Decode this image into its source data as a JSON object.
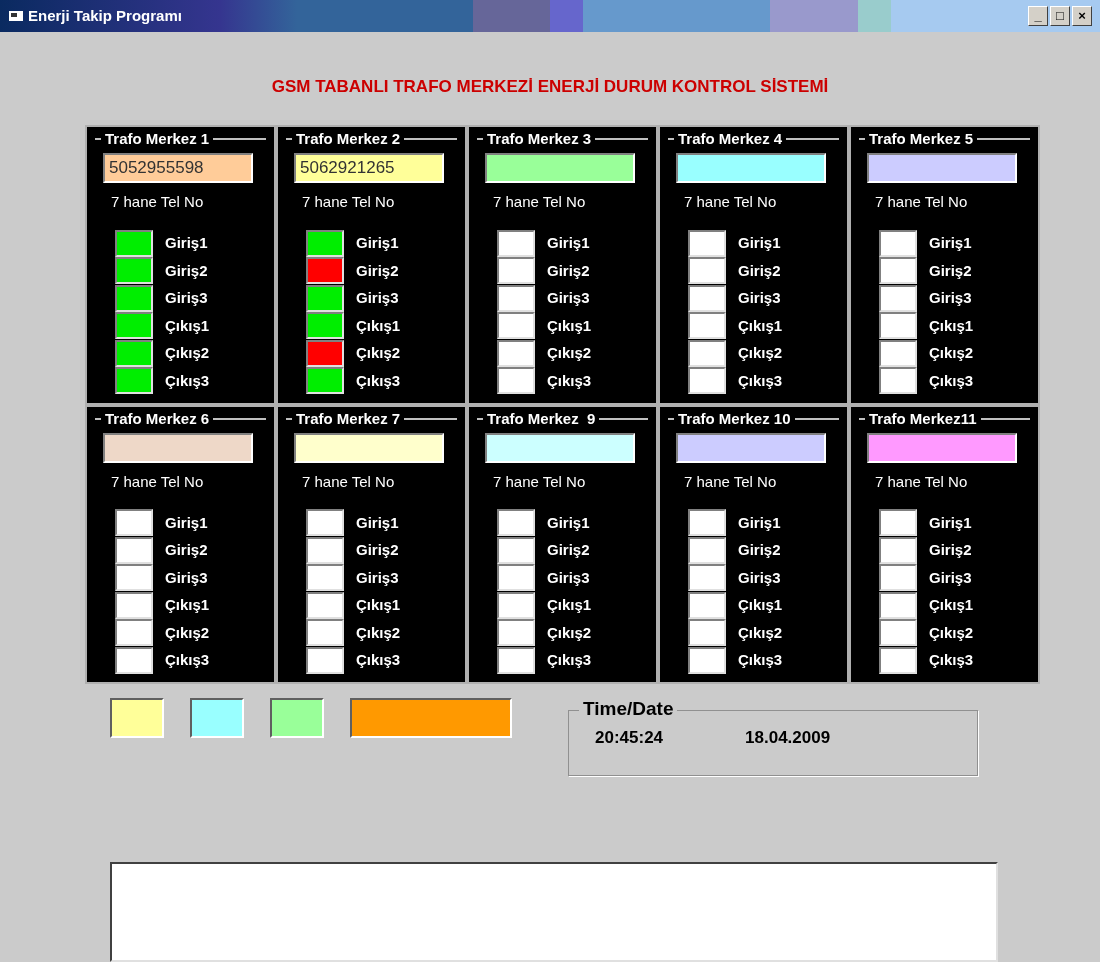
{
  "window": {
    "title": "Enerji Takip Programı",
    "controls": [
      "_",
      "□",
      "×"
    ]
  },
  "heading": "GSM TABANLI TRAFO MERKEZİ ENERJİ DURUM KONTROL SİSTEMİ",
  "stations": [
    {
      "title": "Trafo Merkez 1",
      "phone": "5052955598",
      "color": "#ffcc99",
      "hint": "7 hane Tel No",
      "signals": [
        {
          "label": "Giriş1",
          "color": "#00ee00"
        },
        {
          "label": "Giriş2",
          "color": "#00ee00"
        },
        {
          "label": "Giriş3",
          "color": "#00ee00"
        },
        {
          "label": "Çıkış1",
          "color": "#00ee00"
        },
        {
          "label": "Çıkış2",
          "color": "#00ee00"
        },
        {
          "label": "Çıkış3",
          "color": "#00ee00"
        }
      ]
    },
    {
      "title": "Trafo Merkez 2",
      "phone": "5062921265",
      "color": "#ffff99",
      "hint": "7 hane Tel No",
      "signals": [
        {
          "label": "Giriş1",
          "color": "#00ee00"
        },
        {
          "label": "Giriş2",
          "color": "#ff0000"
        },
        {
          "label": "Giriş3",
          "color": "#00ee00"
        },
        {
          "label": "Çıkış1",
          "color": "#00ee00"
        },
        {
          "label": "Çıkış2",
          "color": "#ff0000"
        },
        {
          "label": "Çıkış3",
          "color": "#00ee00"
        }
      ]
    },
    {
      "title": "Trafo Merkez 3",
      "color": "#99ff99",
      "hint": "7 hane Tel No",
      "signals": [
        {
          "label": "Giriş1",
          "color": "#ffffff"
        },
        {
          "label": "Giriş2",
          "color": "#ffffff"
        },
        {
          "label": "Giriş3",
          "color": "#ffffff"
        },
        {
          "label": "Çıkış1",
          "color": "#ffffff"
        },
        {
          "label": "Çıkış2",
          "color": "#ffffff"
        },
        {
          "label": "Çıkış3",
          "color": "#ffffff"
        }
      ]
    },
    {
      "title": "Trafo Merkez 4",
      "color": "#99ffff",
      "hint": "7 hane Tel No",
      "signals": [
        {
          "label": "Giriş1",
          "color": "#ffffff"
        },
        {
          "label": "Giriş2",
          "color": "#ffffff"
        },
        {
          "label": "Giriş3",
          "color": "#ffffff"
        },
        {
          "label": "Çıkış1",
          "color": "#ffffff"
        },
        {
          "label": "Çıkış2",
          "color": "#ffffff"
        },
        {
          "label": "Çıkış3",
          "color": "#ffffff"
        }
      ]
    },
    {
      "title": "Trafo Merkez 5",
      "color": "#ccccff",
      "hint": "7 hane Tel No",
      "signals": [
        {
          "label": "Giriş1",
          "color": "#ffffff"
        },
        {
          "label": "Giriş2",
          "color": "#ffffff"
        },
        {
          "label": "Giriş3",
          "color": "#ffffff"
        },
        {
          "label": "Çıkış1",
          "color": "#ffffff"
        },
        {
          "label": "Çıkış2",
          "color": "#ffffff"
        },
        {
          "label": "Çıkış3",
          "color": "#ffffff"
        }
      ]
    },
    {
      "title": "Trafo Merkez 6",
      "color": "#eed8c8",
      "hint": "7 hane Tel No",
      "signals": [
        {
          "label": "Giriş1",
          "color": "#ffffff"
        },
        {
          "label": "Giriş2",
          "color": "#ffffff"
        },
        {
          "label": "Giriş3",
          "color": "#ffffff"
        },
        {
          "label": "Çıkış1",
          "color": "#ffffff"
        },
        {
          "label": "Çıkış2",
          "color": "#ffffff"
        },
        {
          "label": "Çıkış3",
          "color": "#ffffff"
        }
      ]
    },
    {
      "title": "Trafo Merkez 7",
      "color": "#ffffcc",
      "hint": "7 hane Tel No",
      "signals": [
        {
          "label": "Giriş1",
          "color": "#ffffff"
        },
        {
          "label": "Giriş2",
          "color": "#ffffff"
        },
        {
          "label": "Giriş3",
          "color": "#ffffff"
        },
        {
          "label": "Çıkış1",
          "color": "#ffffff"
        },
        {
          "label": "Çıkış2",
          "color": "#ffffff"
        },
        {
          "label": "Çıkış3",
          "color": "#ffffff"
        }
      ]
    },
    {
      "title": "Trafo Merkez  9",
      "color": "#ccffff",
      "hint": "7 hane Tel No",
      "signals": [
        {
          "label": "Giriş1",
          "color": "#ffffff"
        },
        {
          "label": "Giriş2",
          "color": "#ffffff"
        },
        {
          "label": "Giriş3",
          "color": "#ffffff"
        },
        {
          "label": "Çıkış1",
          "color": "#ffffff"
        },
        {
          "label": "Çıkış2",
          "color": "#ffffff"
        },
        {
          "label": "Çıkış3",
          "color": "#ffffff"
        }
      ]
    },
    {
      "title": "Trafo Merkez 10",
      "color": "#ccccff",
      "hint": "7 hane Tel No",
      "signals": [
        {
          "label": "Giriş1",
          "color": "#ffffff"
        },
        {
          "label": "Giriş2",
          "color": "#ffffff"
        },
        {
          "label": "Giriş3",
          "color": "#ffffff"
        },
        {
          "label": "Çıkış1",
          "color": "#ffffff"
        },
        {
          "label": "Çıkış2",
          "color": "#ffffff"
        },
        {
          "label": "Çıkış3",
          "color": "#ffffff"
        }
      ]
    },
    {
      "title": "Trafo Merkez11",
      "color": "#ff99ff",
      "hint": "7 hane Tel No",
      "signals": [
        {
          "label": "Giriş1",
          "color": "#ffffff"
        },
        {
          "label": "Giriş2",
          "color": "#ffffff"
        },
        {
          "label": "Giriş3",
          "color": "#ffffff"
        },
        {
          "label": "Çıkış1",
          "color": "#ffffff"
        },
        {
          "label": "Çıkış2",
          "color": "#ffffff"
        },
        {
          "label": "Çıkış3",
          "color": "#ffffff"
        }
      ]
    }
  ],
  "swatches": [
    {
      "color": "#ffff99"
    },
    {
      "color": "#99ffff"
    },
    {
      "color": "#99ff99"
    },
    {
      "color": "#ff9900"
    }
  ],
  "time_date": {
    "label": "Time/Date",
    "time": "20:45:24",
    "date": "18.04.2009"
  }
}
